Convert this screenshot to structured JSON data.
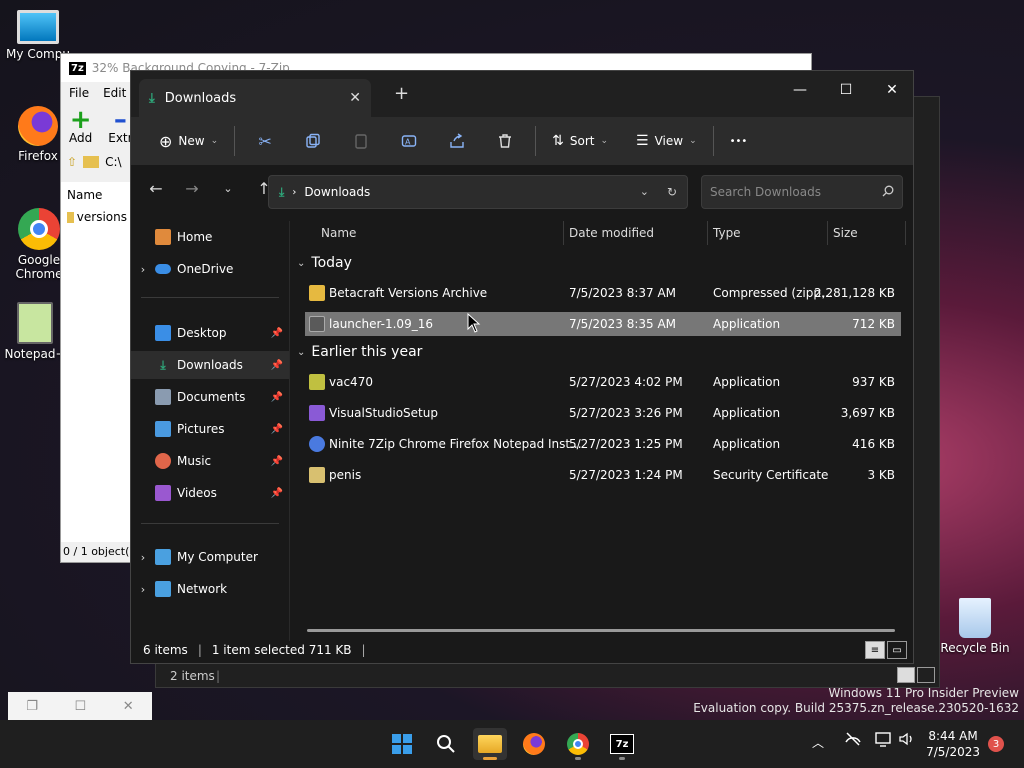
{
  "desktop": {
    "icons": [
      {
        "label": "My Compu",
        "icon": "computer-icon"
      },
      {
        "label": "Firefox",
        "icon": "firefox-icon"
      },
      {
        "label": "Google Chrome",
        "icon": "chrome-icon"
      },
      {
        "label": "Notepad+",
        "icon": "notepadpp-icon"
      },
      {
        "label": "Recycle Bin",
        "icon": "recycle-bin-icon"
      }
    ],
    "watermark_line1": "Windows 11 Pro Insider Preview",
    "watermark_line2": "Evaluation copy. Build 25375.zn_release.230520-1632"
  },
  "sevenzip": {
    "badge": "7z",
    "title": "32% Background Copying - 7-Zip",
    "menu": [
      "File",
      "Edit"
    ],
    "tools": [
      "Add",
      "Extr"
    ],
    "address": "C:\\",
    "column": "Name",
    "item": "versions",
    "status": "0 / 1 object(s"
  },
  "bg_explorer": {
    "status": "2 items"
  },
  "explorer": {
    "tab_title": "Downloads",
    "tab_close": "✕",
    "new_tab": "+",
    "toolbar": {
      "new_label": "New",
      "sort_label": "Sort",
      "view_label": "View",
      "more": "•••"
    },
    "address": {
      "location": "Downloads"
    },
    "search": {
      "placeholder": "Search Downloads"
    },
    "nav": [
      {
        "label": "Home",
        "icon": "home-icon",
        "color": "#e08a3c"
      },
      {
        "label": "OneDrive",
        "icon": "onedrive-icon",
        "color": "#3a8ee6"
      },
      {
        "label": "Desktop",
        "icon": "desktop-icon",
        "color": "#3a8ee6"
      },
      {
        "label": "Downloads",
        "icon": "downloads-icon",
        "color": "#2ea77a"
      },
      {
        "label": "Documents",
        "icon": "documents-icon",
        "color": "#8a9bb0"
      },
      {
        "label": "Pictures",
        "icon": "pictures-icon",
        "color": "#4a9ae0"
      },
      {
        "label": "Music",
        "icon": "music-icon",
        "color": "#e0664a"
      },
      {
        "label": "Videos",
        "icon": "videos-icon",
        "color": "#9a58d0"
      },
      {
        "label": "My Computer",
        "icon": "computer-icon",
        "color": "#4aa0e0"
      },
      {
        "label": "Network",
        "icon": "network-icon",
        "color": "#4aa0e0"
      }
    ],
    "columns": {
      "name": "Name",
      "date": "Date modified",
      "type": "Type",
      "size": "Size"
    },
    "groups": [
      "Today",
      "Earlier this year"
    ],
    "files": [
      {
        "name": "Betacraft Versions Archive",
        "date": "7/5/2023 8:37 AM",
        "type": "Compressed (zipp...",
        "size": "2,281,128 KB",
        "icon": "zip-folder-icon",
        "color": "#e6b940"
      },
      {
        "name": "launcher-1.09_16",
        "date": "7/5/2023 8:35 AM",
        "type": "Application",
        "size": "712 KB",
        "icon": "app-icon",
        "color": "#7a7a7a"
      },
      {
        "name": "vac470",
        "date": "5/27/2023 4:02 PM",
        "type": "Application",
        "size": "937 KB",
        "icon": "app-icon",
        "color": "#c0c040"
      },
      {
        "name": "VisualStudioSetup",
        "date": "5/27/2023 3:26 PM",
        "type": "Application",
        "size": "3,697 KB",
        "icon": "visual-studio-icon",
        "color": "#8a5ad6"
      },
      {
        "name": "Ninite 7Zip Chrome Firefox Notepad Inst...",
        "date": "5/27/2023 1:25 PM",
        "type": "Application",
        "size": "416 KB",
        "icon": "ninite-icon",
        "color": "#4a7ae0"
      },
      {
        "name": "penis",
        "date": "5/27/2023 1:24 PM",
        "type": "Security Certificate",
        "size": "3 KB",
        "icon": "certificate-icon",
        "color": "#d8c070"
      }
    ],
    "status": {
      "items": "6 items",
      "selected": "1 item selected  711 KB"
    }
  },
  "taskbar": {
    "time": "8:44 AM",
    "date": "7/5/2023",
    "notifications": "3"
  },
  "colors": {
    "accent": "#e9a13b",
    "selection": "#777777",
    "explorer_bg": "#191919"
  }
}
